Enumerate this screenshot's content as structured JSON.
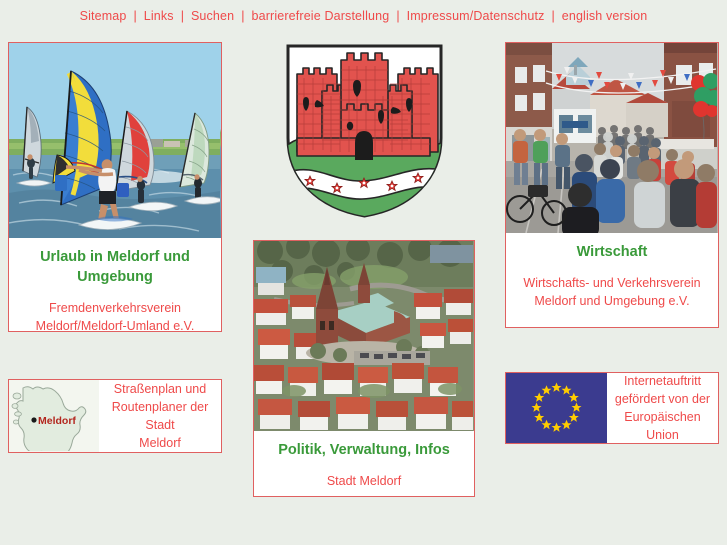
{
  "nav": {
    "separator": "|",
    "items": [
      {
        "label": "Sitemap",
        "name": "nav-sitemap"
      },
      {
        "label": "Links",
        "name": "nav-links"
      },
      {
        "label": "Suchen",
        "name": "nav-suchen"
      },
      {
        "label": "barrierefreie Darstellung",
        "name": "nav-barrierefreie-darstellung"
      },
      {
        "label": "Impressum/Datenschutz",
        "name": "nav-impressum-datenschutz"
      },
      {
        "label": "english version",
        "name": "nav-english-version"
      }
    ]
  },
  "panels": {
    "urlaub": {
      "title": "Urlaub in Meldorf und Umgebung",
      "subtitle_line1": "Fremdenverkehrsverein",
      "subtitle_line2": "Meldorf/Meldorf-Umland e.V.",
      "image_alt": "windsurfing-photo"
    },
    "wirtschaft": {
      "title": "Wirtschaft",
      "subtitle_line1": "Wirtschafts- und Verkehrsverein",
      "subtitle_line2": "Meldorf und Umgebung e.V.",
      "image_alt": "street-festival-photo"
    },
    "politik": {
      "title": "Politik, Verwaltung, Infos",
      "subtitle_line1": "Stadt Meldorf",
      "image_alt": "aerial-town-photo"
    },
    "strassenplan": {
      "text_line1": "Straßenplan und",
      "text_line2": "Routenplaner der Stadt",
      "text_line3": "Meldorf",
      "map_label": "Meldorf",
      "map_alt": "schleswig-holstein-map"
    },
    "eu": {
      "text_line1": "Internetauftritt",
      "text_line2": "gefördert von der",
      "text_line3": "Europäischen Union",
      "flag_alt": "european-union-flag"
    }
  },
  "coat_of_arms": {
    "alt": "meldorf-coat-of-arms",
    "description": "Red castle with five towers on white field above green mound with white wavy band bearing five red roses"
  },
  "colors": {
    "page_background": "#eaeee8",
    "link_red": "#ef4a4a",
    "heading_green": "#3a9a3a",
    "border_red": "#e06060",
    "eu_blue": "#3b3b8f",
    "eu_star_yellow": "#ffcc00",
    "arms_red": "#e23b36",
    "arms_green": "#5aa95e"
  }
}
